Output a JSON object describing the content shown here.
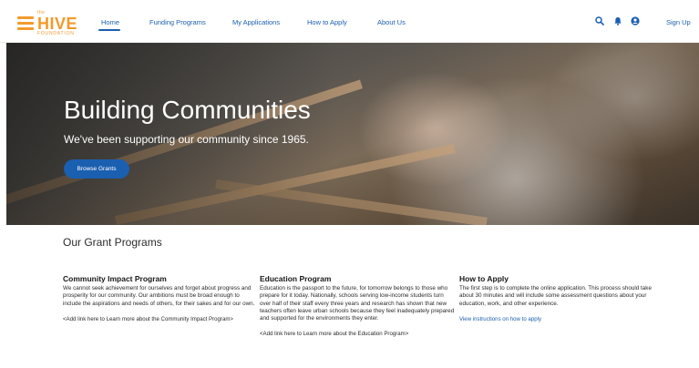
{
  "brand": {
    "top": "the",
    "name": "HIVE",
    "sub": "FOUNDATION",
    "color": "#f39a2c"
  },
  "nav": {
    "items": [
      {
        "label": "Home",
        "active": true
      },
      {
        "label": "Funding Programs"
      },
      {
        "label": "My Applications"
      },
      {
        "label": "How to Apply"
      },
      {
        "label": "About Us"
      }
    ],
    "signup": "Sign Up",
    "icons": [
      "search-icon",
      "bell-icon",
      "user-icon"
    ],
    "accent": "#1b5fb0"
  },
  "hero": {
    "title": "Building Communities",
    "subtitle": "We've been supporting our community since 1965.",
    "button": "Browse Grants"
  },
  "programs": {
    "heading": "Our Grant Programs",
    "cards": [
      {
        "title": "Community Impact Program",
        "body": "We cannot seek achievement for ourselves and forget about progress and prosperity for our community. Our ambitions must be broad enough to include the aspirations and needs of others, for their sakes and for our own.",
        "link": "<Add link here to Learn more about the Community Impact Program>"
      },
      {
        "title": "Education Program",
        "body": "Education is the passport to the future, for tomorrow belongs to those who prepare for it today. Nationally, schools serving low-income students turn over half of their staff every three years and research has shown that new teachers often leave urban schools because they feel inadequately prepared and supported for the environments they enter.",
        "link": "<Add link here to Learn more about the Education Program>"
      },
      {
        "title": "How to Apply",
        "body": "The first step is to complete the online application. This process should take about 30 minutes and will include some assessment questions about your education, work, and other experience.",
        "link": "View instructions on how to apply"
      }
    ]
  }
}
